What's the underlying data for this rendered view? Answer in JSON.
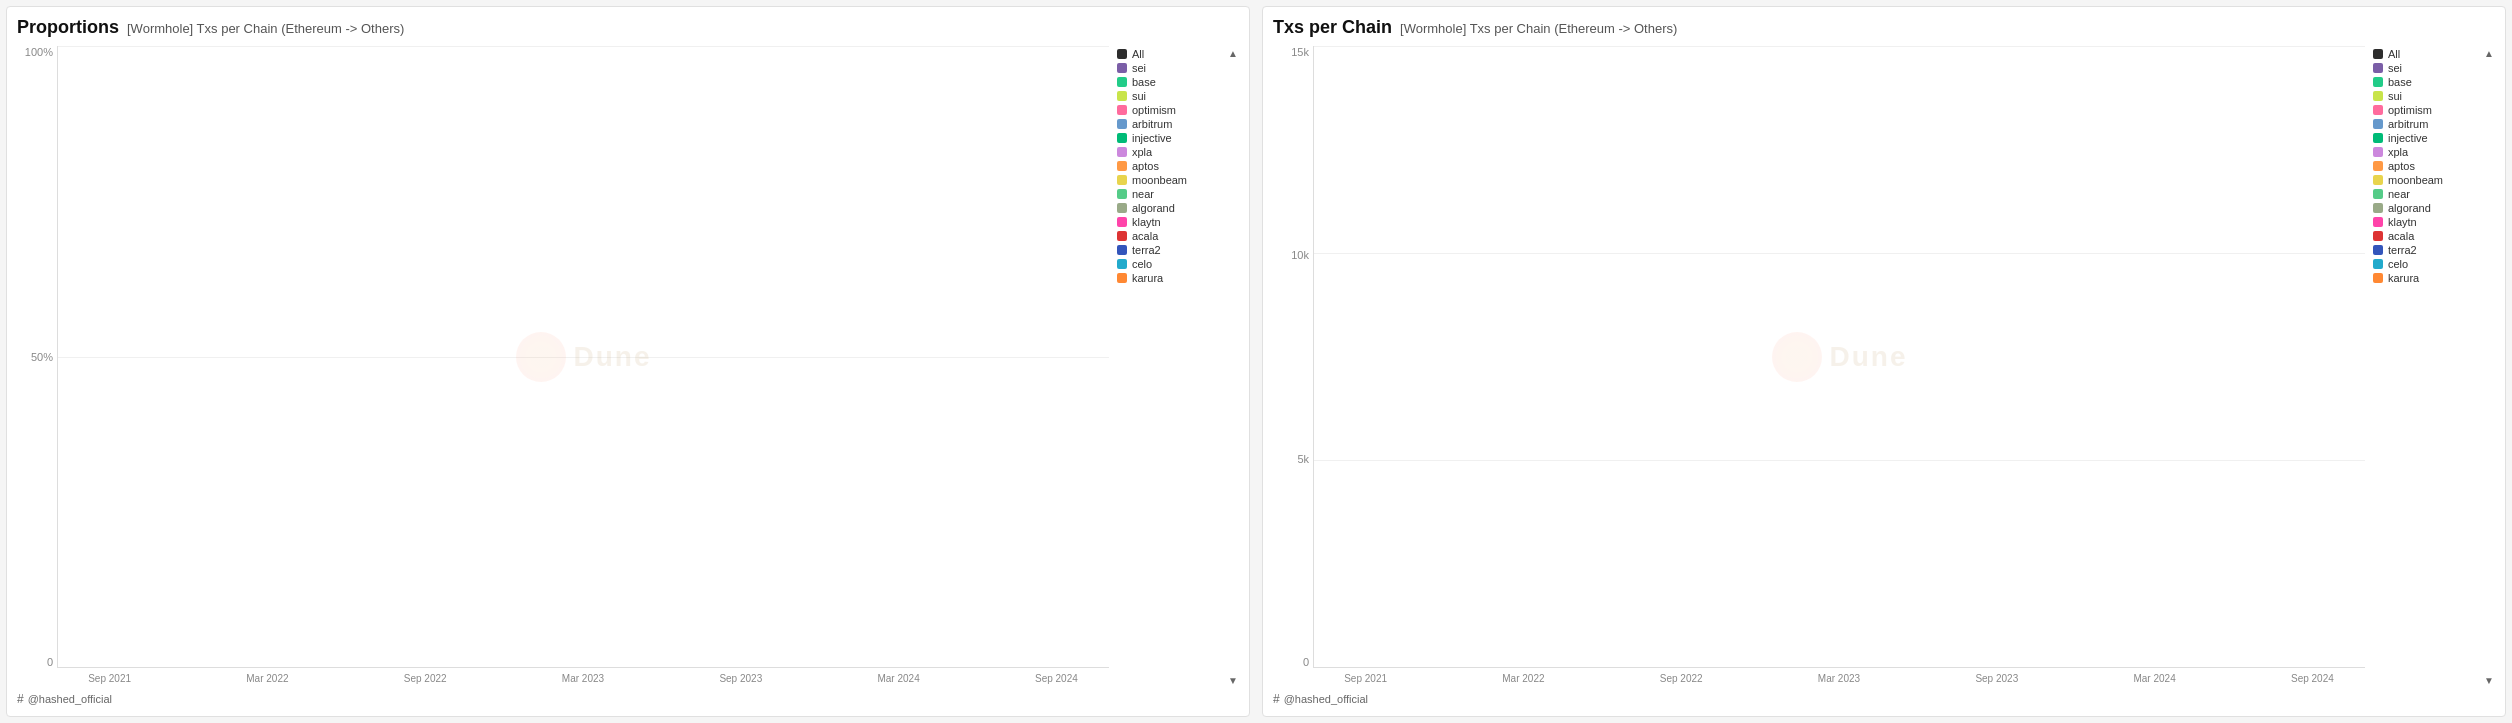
{
  "panel1": {
    "title_main": "Proportions",
    "title_sub": "[Wormhole] Txs per Chain (Ethereum -> Others)",
    "y_labels": [
      "100%",
      "50%",
      "0"
    ],
    "x_labels": [
      "Sep 2021",
      "Mar 2022",
      "Sep 2022",
      "Mar 2023",
      "Sep 2023",
      "Mar 2024",
      "Sep 2024"
    ],
    "footer_user": "@hashed_official"
  },
  "panel2": {
    "title_main": "Txs per Chain",
    "title_sub": "[Wormhole] Txs per Chain (Ethereum -> Others)",
    "y_labels": [
      "15k",
      "10k",
      "5k",
      "0"
    ],
    "x_labels": [
      "Sep 2021",
      "Mar 2022",
      "Sep 2022",
      "Mar 2023",
      "Sep 2023",
      "Mar 2024",
      "Sep 2024"
    ],
    "footer_user": "@hashed_official"
  },
  "legend": {
    "items": [
      {
        "label": "All",
        "color": "#2d2d2d"
      },
      {
        "label": "sei",
        "color": "#7b5ea7"
      },
      {
        "label": "base",
        "color": "#22cc88"
      },
      {
        "label": "sui",
        "color": "#c8e44a"
      },
      {
        "label": "optimism",
        "color": "#ff6b9d"
      },
      {
        "label": "arbitrum",
        "color": "#6699cc"
      },
      {
        "label": "injective",
        "color": "#00bb77"
      },
      {
        "label": "xpla",
        "color": "#cc88dd"
      },
      {
        "label": "aptos",
        "color": "#ff9944"
      },
      {
        "label": "moonbeam",
        "color": "#e8d44d"
      },
      {
        "label": "near",
        "color": "#55cc88"
      },
      {
        "label": "algorand",
        "color": "#99aa88"
      },
      {
        "label": "klaytn",
        "color": "#ff44aa"
      },
      {
        "label": "acala",
        "color": "#dd3333"
      },
      {
        "label": "terra2",
        "color": "#3355bb"
      },
      {
        "label": "celo",
        "color": "#22aacc"
      },
      {
        "label": "karura",
        "color": "#ff8833"
      }
    ]
  },
  "colors": {
    "green": "#22cc88",
    "blue": "#2244bb",
    "yellow": "#e8d44d",
    "orange": "#ff9944",
    "pink": "#ff6b9d",
    "purple": "#7b5ea7",
    "light_blue": "#6699cc",
    "red": "#dd3333",
    "teal": "#22aacc",
    "lime": "#c8e44a",
    "magenta": "#ff44aa",
    "dark_green": "#00bb77",
    "gray": "#99aa88",
    "dark": "#2d2d2d"
  }
}
